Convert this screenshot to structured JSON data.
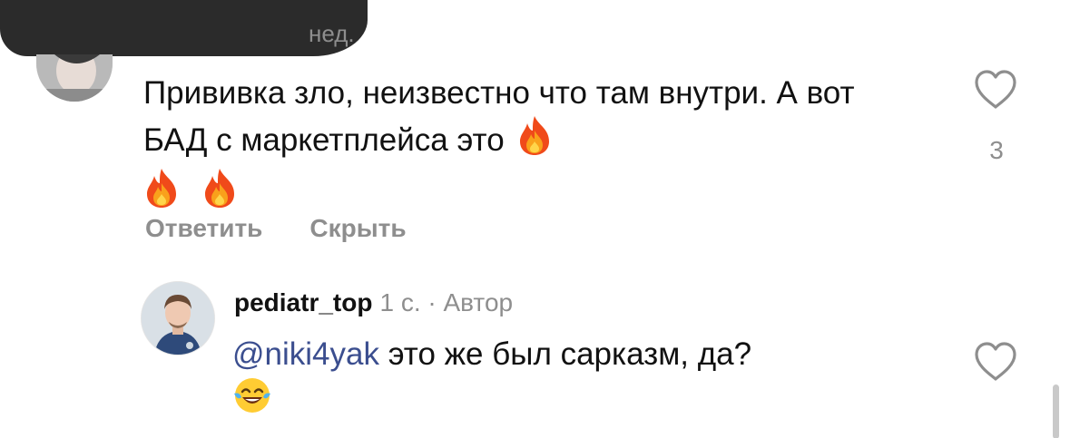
{
  "comment": {
    "header_tail": "нед.",
    "text": "Прививка зло, неизвестно что там внутри. А вот БАД с маркетплейса это",
    "likes": "3",
    "actions": {
      "reply": "Ответить",
      "hide": "Скрыть"
    }
  },
  "reply": {
    "username": "pediatr_top",
    "time": "1 с.",
    "separator": "·",
    "author_badge": "Автор",
    "mention": "@niki4yak",
    "text": "это же был сарказм, да?"
  },
  "icons": {
    "fire": "fire-emoji-icon",
    "laugh": "tears-of-joy-emoji-icon",
    "like": "heart-outline-icon"
  },
  "colors": {
    "text": "#111111",
    "secondary": "#8e8e8e",
    "mention": "#3b4e8f",
    "redaction": "#2b2b2b"
  }
}
